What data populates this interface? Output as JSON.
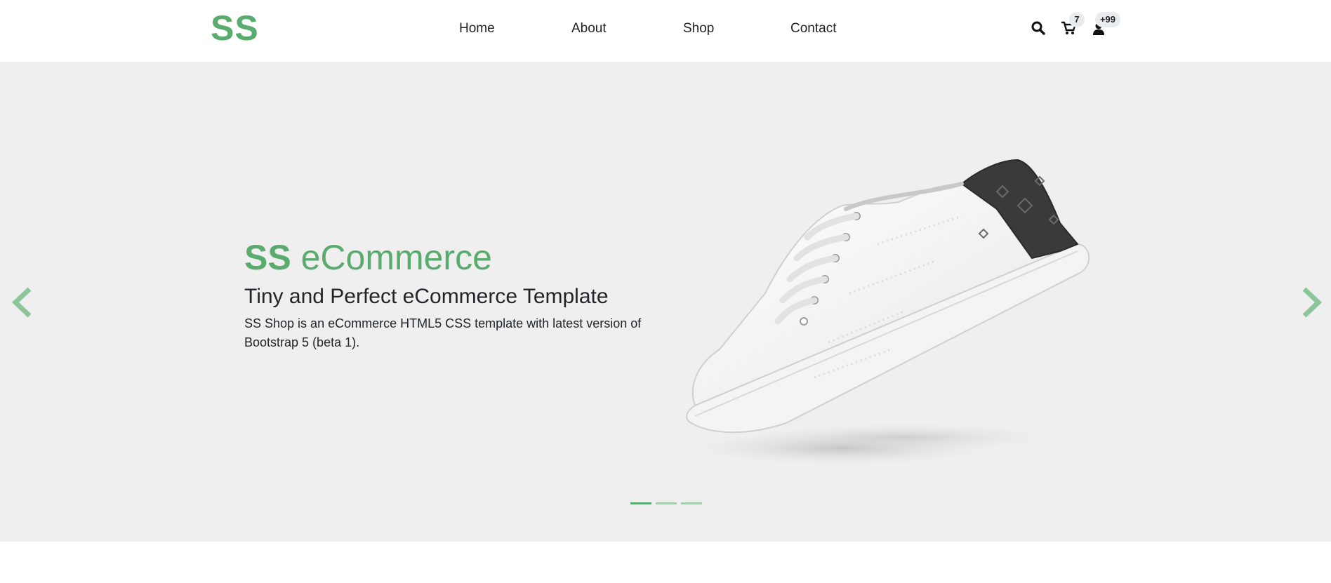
{
  "header": {
    "logo": "SS",
    "nav": [
      "Home",
      "About",
      "Shop",
      "Contact"
    ],
    "cart_badge": "7",
    "user_badge": "+99",
    "icons": [
      "search-icon",
      "cart-icon",
      "user-icon"
    ]
  },
  "hero": {
    "title_brand": "SS",
    "title_rest": " eCommerce",
    "subtitle": "Tiny and Perfect eCommerce Template",
    "description": "SS Shop is an eCommerce HTML5 CSS template with latest version of Bootstrap 5 (beta 1).",
    "slides_count": 3,
    "active_slide": 1,
    "image": "white sneaker with dark patterned heel"
  },
  "colors": {
    "brand": "#59ab6e",
    "hero_bg": "#efefef",
    "text": "#212529"
  }
}
